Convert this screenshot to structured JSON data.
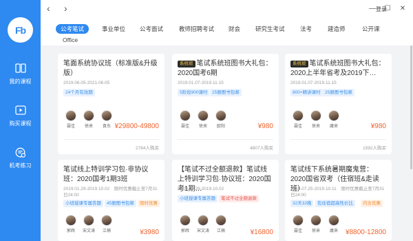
{
  "logo": {
    "text": "Fb"
  },
  "nav": [
    {
      "label": "我的课程"
    },
    {
      "label": "购买课程"
    },
    {
      "label": "机考练习"
    }
  ],
  "topbar": {
    "back_glyph": "‹",
    "forward_glyph": "›",
    "login": "登录",
    "min_glyph": "—",
    "max_glyph": "☐",
    "close_glyph": "✕"
  },
  "categories": [
    {
      "label": "公考笔试",
      "active": true
    },
    {
      "label": "事业单位"
    },
    {
      "label": "公考面试"
    },
    {
      "label": "教师招聘考试"
    },
    {
      "label": "财会"
    },
    {
      "label": "研究生考试"
    },
    {
      "label": "法考"
    },
    {
      "label": "建造师"
    },
    {
      "label": "公开课"
    },
    {
      "label": "Office"
    }
  ],
  "badge_text": "系统班",
  "cards": [
    {
      "title": "笔面系统协议班（标准版&升级版）",
      "date": "2019.06.05-2021.06.05",
      "tags": [
        {
          "text": "24个月有效期",
          "style": "blue"
        }
      ],
      "teachers": [
        "聂佳",
        "徐来",
        "袁东"
      ],
      "price": "¥29800-49800",
      "buyers": "2784人购买"
    },
    {
      "title": "笔试系统班图书大礼包：2020国考6期",
      "badge": true,
      "date": "2019.01.07-2019.11.15",
      "tags": [
        {
          "text": "5阶段900课时",
          "style": "blue"
        },
        {
          "text": "25册图书包邮",
          "style": "blue"
        }
      ],
      "teachers": [
        "聂佳",
        "徐来",
        "欧阳"
      ],
      "price": "¥980",
      "buyers": "4807人购买"
    },
    {
      "title": "笔试系统班图书大礼包：2020上半年省考及2019下…",
      "badge": true,
      "date": "2019.01.07-2019.11.15",
      "tags": [
        {
          "text": "800+精讲课时",
          "style": "blue"
        },
        {
          "text": "25册图书包邮",
          "style": "blue"
        }
      ],
      "teachers": [
        "聂佳",
        "徐来",
        "庸来"
      ],
      "price": "¥980",
      "buyers": "1592人购买"
    },
    {
      "title": "笔试线上特训学习包·非协议班：2020国考1期3班",
      "date": "2019.01.29-2019.10.02　限时优惠截止至7月31日24:00",
      "tags": [
        {
          "text": "小班授课专属答题",
          "style": "blue"
        },
        {
          "text": "45册图书包邮",
          "style": "blue"
        },
        {
          "text": "限时优惠",
          "style": "orange"
        }
      ],
      "teachers": [
        "郭辉",
        "宋文涛",
        "江楠"
      ],
      "price": "¥3980",
      "buyers": ""
    },
    {
      "title": "【笔试不过全额退款】笔试线上特训学习包·协议班：2020国考1期…",
      "date": "2019.01.29-2019.10.02",
      "tags": [
        {
          "text": "小班授课专属答题",
          "style": "blue"
        },
        {
          "text": "笔试不过全额退款",
          "style": "red"
        }
      ],
      "teachers": [
        "郭辉",
        "宋文涛",
        "江楠"
      ],
      "price": "¥16800",
      "buyers": ""
    },
    {
      "title": "笔试线下系统暑期魔鬼营：2020国省双考（住宿班&走读班）",
      "date": "2019.07.25-2019.10.11　限时优惠截止至7月31日24:00",
      "tags": [
        {
          "text": "32天32晚",
          "style": "blue"
        },
        {
          "text": "包住宿超高性价比",
          "style": "blue"
        },
        {
          "text": "内含优惠",
          "style": "orange"
        }
      ],
      "teachers": [
        "聂佳",
        "徐来",
        "庸来"
      ],
      "price": "¥8800-12800",
      "buyers": ""
    }
  ]
}
